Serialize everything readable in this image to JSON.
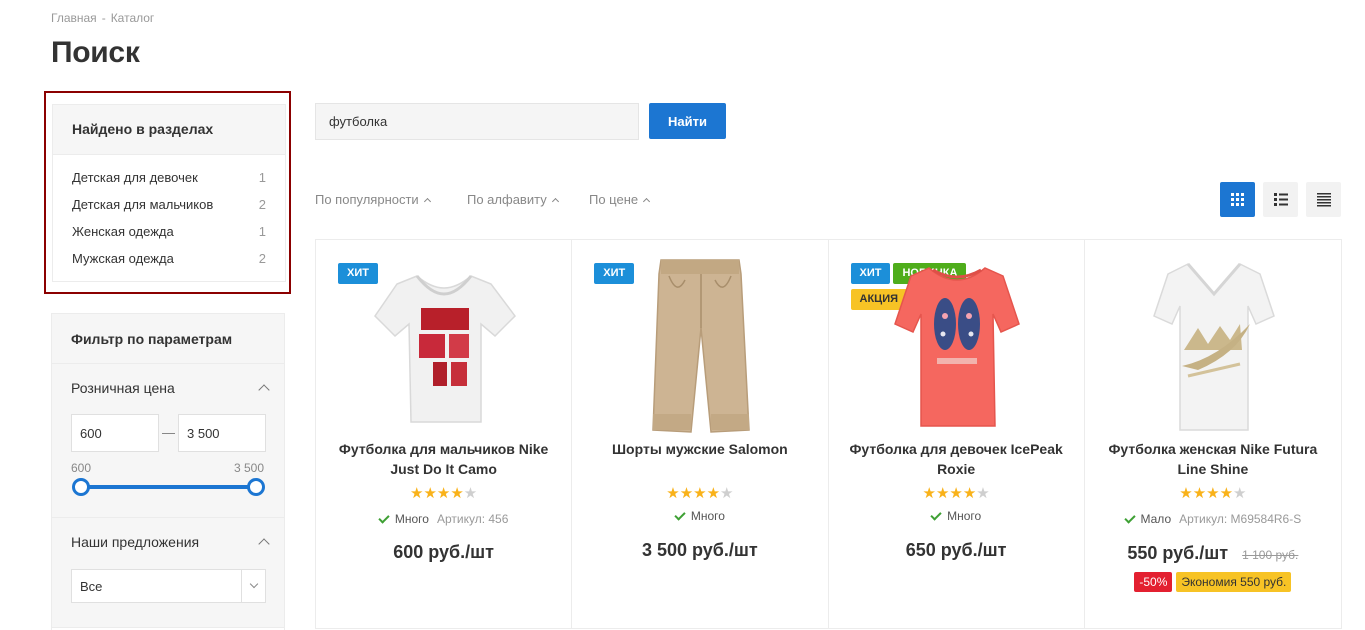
{
  "breadcrumbs": {
    "home": "Главная",
    "separator": "-",
    "catalog": "Каталог"
  },
  "page_title": "Поиск",
  "found_sections": {
    "title": "Найдено в разделах",
    "items": [
      {
        "label": "Детская для девочек",
        "count": "1"
      },
      {
        "label": "Детская для мальчиков",
        "count": "2"
      },
      {
        "label": "Женская одежда",
        "count": "1"
      },
      {
        "label": "Мужская одежда",
        "count": "2"
      }
    ]
  },
  "filter": {
    "title": "Фильтр по параметрам",
    "price": {
      "title": "Розничная цена",
      "from": "600",
      "to": "3 500",
      "min_label": "600",
      "max_label": "3 500",
      "dash": "—"
    },
    "offers": {
      "title": "Наши предложения",
      "selected": "Все"
    }
  },
  "search": {
    "value": "футболка",
    "button": "Найти"
  },
  "sorting": [
    {
      "label": "По популярности"
    },
    {
      "label": "По алфавиту"
    },
    {
      "label": "По цене"
    }
  ],
  "colors": {
    "accent": "#1c76d2",
    "hit": "#1c8fd9",
    "new": "#4fad1b",
    "sale": "#f7c325",
    "discount": "#e32030",
    "savings": "#f7c325",
    "star": "#f9b21a"
  },
  "products": [
    {
      "badges": [
        {
          "text": "ХИТ",
          "type": "hit"
        }
      ],
      "name": "Футболка для мальчиков Nike Just Do It Camo",
      "rating": 4,
      "stock": "Много",
      "article": "Артикул: 456",
      "price": "600 руб./шт",
      "old_price": "",
      "discount": "",
      "savings": ""
    },
    {
      "badges": [
        {
          "text": "ХИТ",
          "type": "hit"
        }
      ],
      "name": "Шорты мужские Salomon",
      "rating": 4,
      "stock": "Много",
      "article": "",
      "price": "3 500 руб./шт",
      "old_price": "",
      "discount": "",
      "savings": ""
    },
    {
      "badges": [
        {
          "text": "ХИТ",
          "type": "hit"
        },
        {
          "text": "НОВИНКА",
          "type": "new"
        },
        {
          "text": "АКЦИЯ",
          "type": "sale"
        }
      ],
      "name": "Футболка для девочек IcePeak Roxie",
      "rating": 4,
      "stock": "Много",
      "article": "",
      "price": "650 руб./шт",
      "old_price": "",
      "discount": "",
      "savings": ""
    },
    {
      "badges": [],
      "name": "Футболка женская Nike Futura Line Shine",
      "rating": 4,
      "stock": "Мало",
      "article": "Артикул: M69584R6-S",
      "price": "550 руб./шт",
      "old_price": "1 100 руб.",
      "discount": "-50%",
      "savings": "Экономия 550 руб."
    }
  ]
}
